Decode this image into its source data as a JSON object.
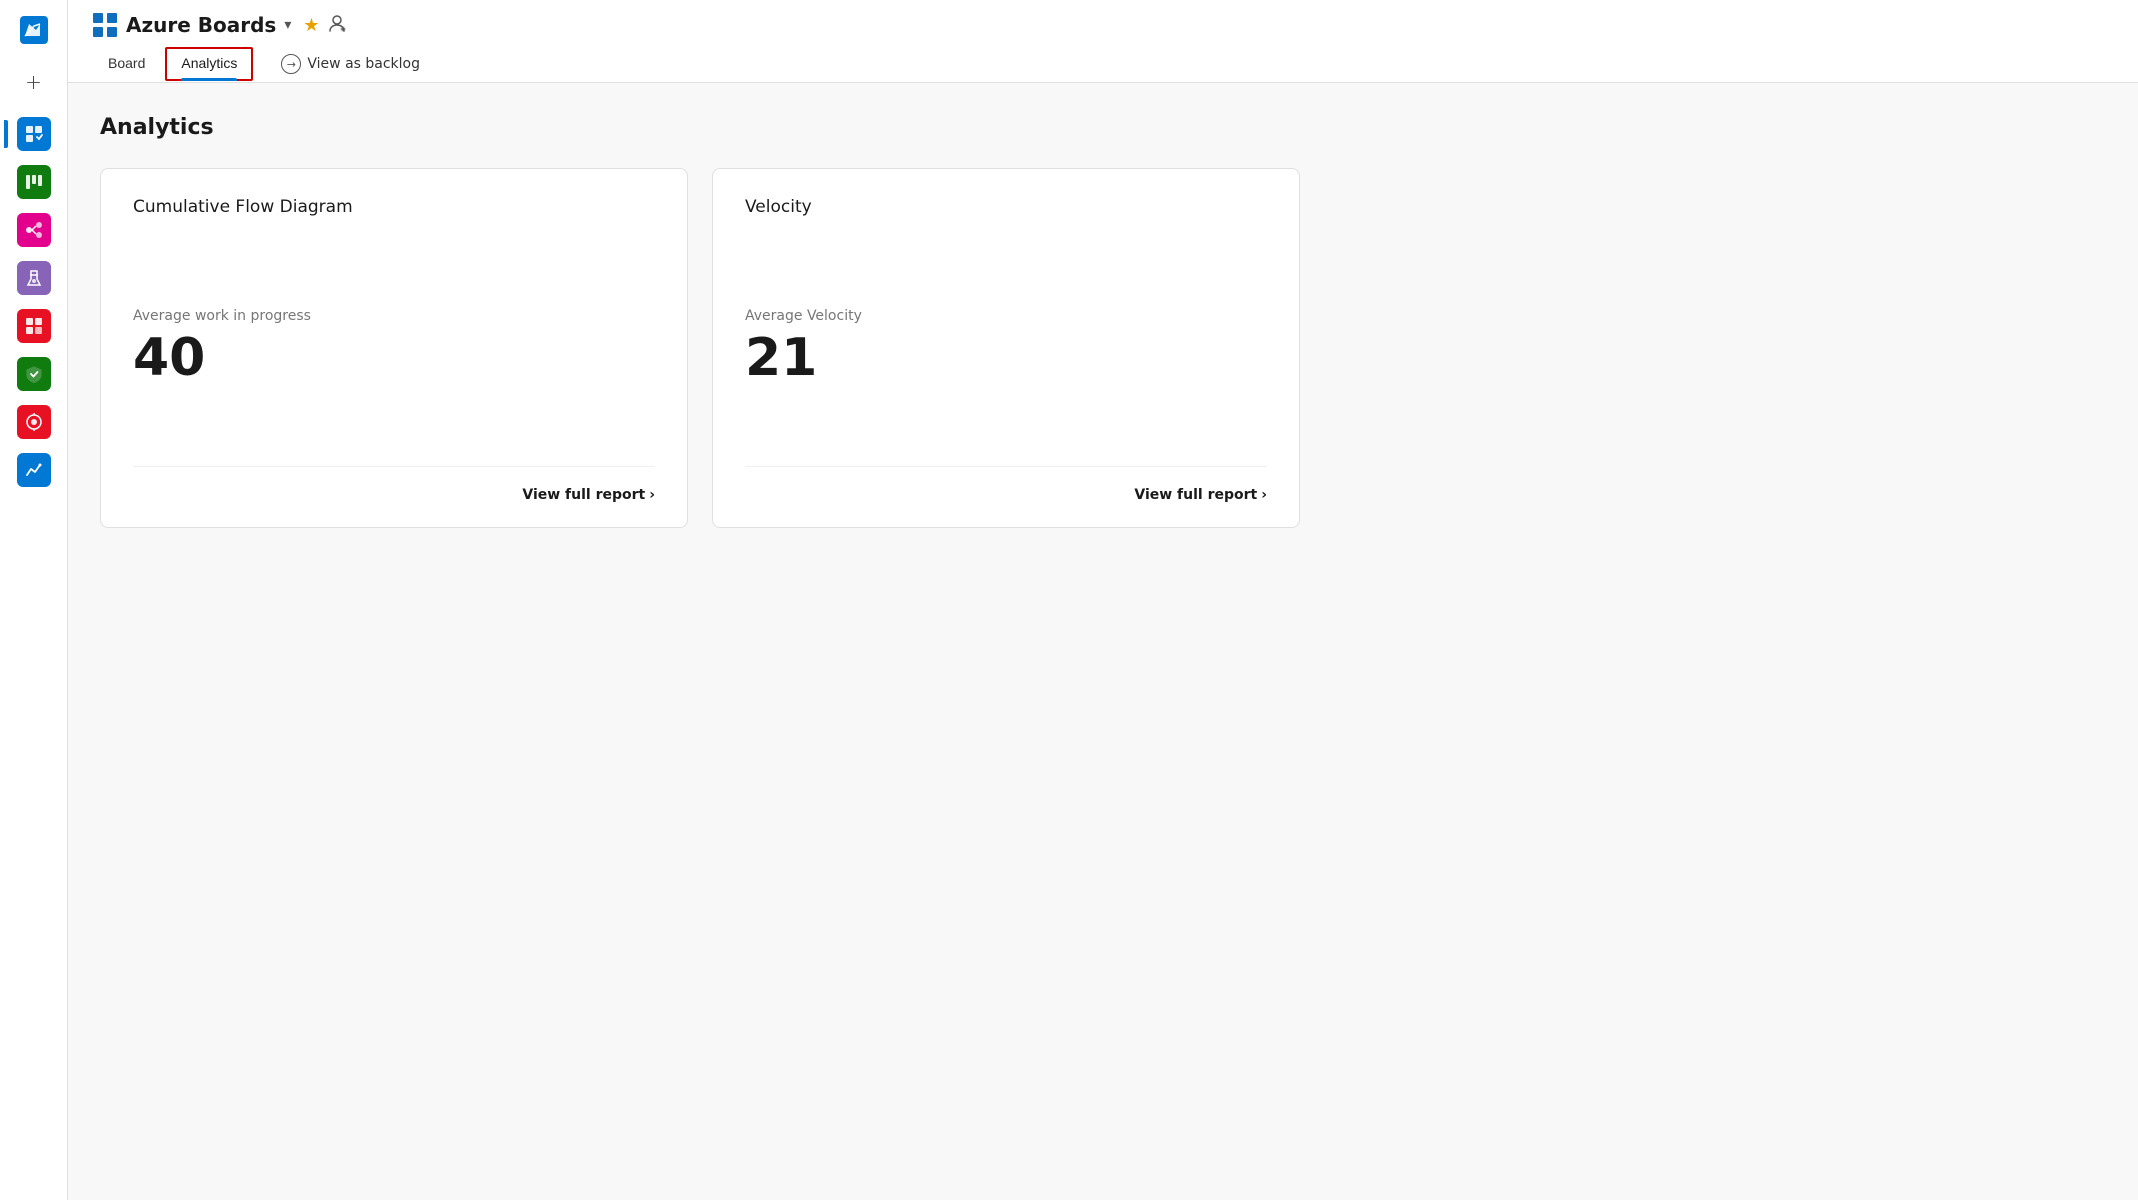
{
  "app": {
    "title": "Azure Boards",
    "title_icon": "grid-icon"
  },
  "header": {
    "title": "Azure Boards",
    "chevron_label": "▾",
    "star_label": "★",
    "person_label": "👤",
    "tabs": [
      {
        "id": "board",
        "label": "Board",
        "active": false
      },
      {
        "id": "analytics",
        "label": "Analytics",
        "active": true
      }
    ],
    "view_backlog_label": "View as backlog"
  },
  "page": {
    "title": "Analytics",
    "cards": [
      {
        "id": "cumulative-flow",
        "title": "Cumulative Flow Diagram",
        "metric_label": "Average work in progress",
        "metric_value": "40",
        "footer_link": "View full report"
      },
      {
        "id": "velocity",
        "title": "Velocity",
        "metric_label": "Average Velocity",
        "metric_value": "21",
        "footer_link": "View full report"
      }
    ]
  },
  "sidebar": {
    "icons": [
      {
        "id": "azure-devops",
        "label": "Azure DevOps",
        "type": "azure"
      },
      {
        "id": "add",
        "label": "Add",
        "type": "plus"
      },
      {
        "id": "boards",
        "label": "Boards",
        "type": "boards"
      },
      {
        "id": "kanban",
        "label": "Kanban",
        "type": "kanban"
      },
      {
        "id": "pipeline",
        "label": "Pipeline",
        "type": "pipeline"
      },
      {
        "id": "test",
        "label": "Test Plans",
        "type": "test"
      },
      {
        "id": "artifact",
        "label": "Artifacts",
        "type": "artifact"
      },
      {
        "id": "security",
        "label": "Security",
        "type": "security"
      },
      {
        "id": "red-tool",
        "label": "Tool",
        "type": "red"
      },
      {
        "id": "analytics-sidebar",
        "label": "Analytics",
        "type": "analytics"
      }
    ]
  }
}
